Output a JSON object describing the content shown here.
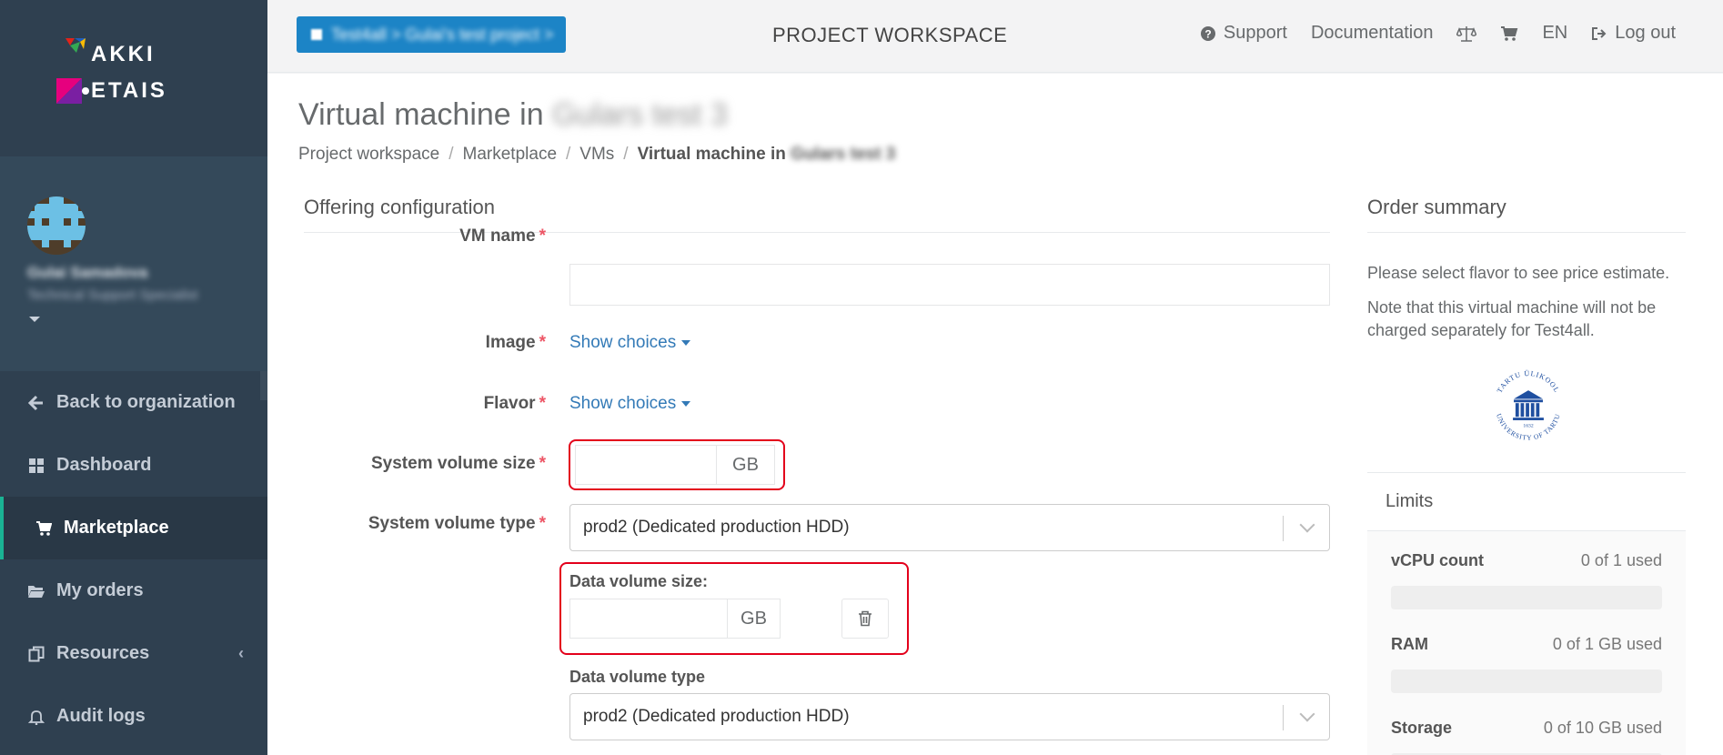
{
  "brand": {
    "logo_line1": "AKKI",
    "logo_line2": "ETAIS"
  },
  "profile": {
    "name": "Gulai Samadova",
    "role": "Technical Support Specialist"
  },
  "sidebar": {
    "items": [
      {
        "label": "Back to organization",
        "icon": "arrow-left-icon"
      },
      {
        "label": "Dashboard",
        "icon": "dashboard-grid-icon"
      },
      {
        "label": "Marketplace",
        "icon": "cart-icon",
        "active": true
      },
      {
        "label": "My orders",
        "icon": "folder-open-icon"
      },
      {
        "label": "Resources",
        "icon": "copy-icon"
      },
      {
        "label": "Audit logs",
        "icon": "bell-icon"
      }
    ]
  },
  "header": {
    "project_button": "Test4all > Gulai's test project >",
    "workspace_title": "PROJECT WORKSPACE",
    "support": "Support",
    "documentation": "Documentation",
    "language": "EN",
    "logout": "Log out"
  },
  "page": {
    "title_prefix": "Virtual machine in",
    "title_project": "Gulars test 3",
    "breadcrumb": [
      "Project workspace",
      "Marketplace",
      "VMs"
    ],
    "breadcrumb_current_prefix": "Virtual machine in",
    "breadcrumb_current_project": "Gulars test 3"
  },
  "form": {
    "section_title": "Offering configuration",
    "vm_name_label": "VM name",
    "vm_name_value": "",
    "image_label": "Image",
    "image_link": "Show choices",
    "flavor_label": "Flavor",
    "flavor_link": "Show choices",
    "system_volume_size_label": "System volume size",
    "system_volume_size_unit": "GB",
    "system_volume_type_label": "System volume type",
    "system_volume_type_value": "prod2 (Dedicated production HDD)",
    "data_volume_size_label": "Data volume size:",
    "data_volume_size_unit": "GB",
    "data_volume_type_label": "Data volume type",
    "data_volume_type_value": "prod2 (Dedicated production HDD)",
    "required_mark": "*"
  },
  "summary": {
    "title": "Order summary",
    "price_note": "Please select flavor to see price estimate.",
    "charge_note": "Note that this virtual machine will not be charged separately for Test4all.",
    "limits_title": "Limits",
    "limits": [
      {
        "name": "vCPU count",
        "value": "0 of 1 used",
        "fraction": 0
      },
      {
        "name": "RAM",
        "value": "0 of 1 GB used",
        "fraction": 0
      },
      {
        "name": "Storage",
        "value": "0 of 10 GB used",
        "fraction": 0
      }
    ]
  },
  "seal": {
    "top_text": "TARTU ÜLIKOOL",
    "bottom_text": "UNIVERSITY OF TARTU",
    "year": "1632"
  },
  "colors": {
    "sidebar_bg": "#2f4050",
    "accent_green": "#1ab394",
    "primary_blue": "#1c84c6",
    "link_blue": "#337ab7",
    "highlight_red": "#e3001b",
    "required_red": "#ed5565"
  }
}
